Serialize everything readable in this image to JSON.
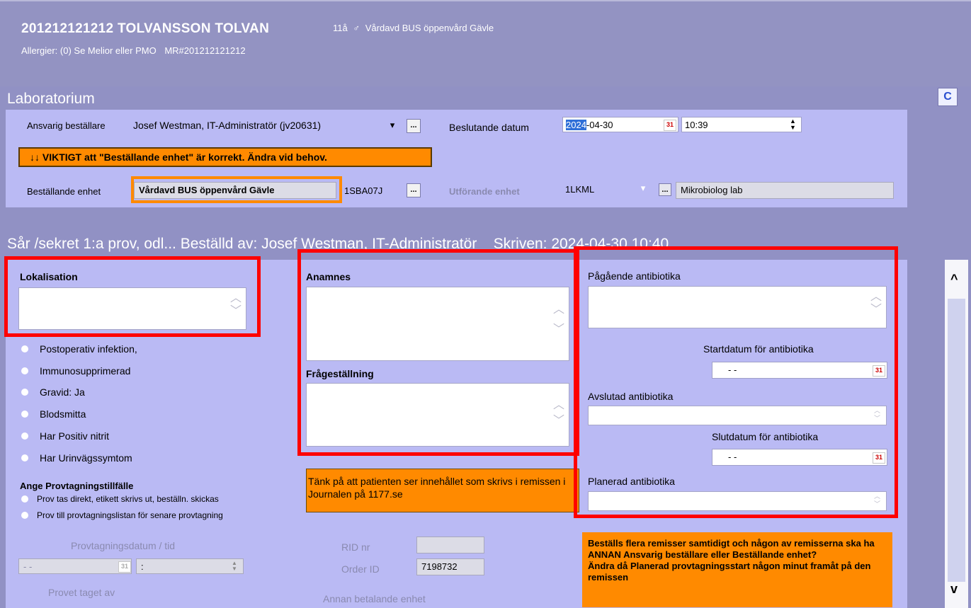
{
  "patient": {
    "name": "201212121212 TOLVANSSON TOLVAN",
    "age": "11å",
    "gender_symbol": "♂",
    "unit": "Vårdavd BUS öppenvård Gävle",
    "allergies": "Allergier: (0) Se Melior eller PMO",
    "mr": "MR#201212121212"
  },
  "lab": {
    "title": "Laboratorium",
    "ansvarig_label": "Ansvarig beställare",
    "ansvarig_value": "Josef Westman, IT-Administratör (jv20631)",
    "beslutande_label": "Beslutande datum",
    "date_year": "2024",
    "date_rest": "-04-30",
    "time_value": "10:39",
    "warning": "↓↓ VIKTIGT att \"Beställande enhet\" är korrekt. Ändra vid behov.",
    "bestallande_label": "Beställande enhet",
    "bestallande_value": "Vårdavd BUS öppenvård Gävle",
    "bestallande_code": "1SBA07J",
    "utforande_label": "Utförande enhet",
    "utforande_code": "1LKML",
    "utforande_name": "Mikrobiolog lab",
    "dots": "..."
  },
  "order": {
    "title": "Sår /sekret 1:a prov, odl... Beställd av: Josef Westman, IT-Administratör    Skriven: 2024-04-30 10:40",
    "lokalisation": "Lokalisation",
    "anamnes": "Anamnes",
    "fragestallning": "Frågeställning",
    "pagaende": "Pågående antibiotika",
    "startdatum": "Startdatum för antibiotika",
    "avslutad": "Avslutad antibiotika",
    "slutdatum": "Slutdatum för antibiotika",
    "planerad": "Planerad antibiotika",
    "date_placeholder": "- -",
    "checks": [
      "Postoperativ infektion,",
      "Immunosupprimerad",
      "Gravid: Ja",
      "Blodsmitta",
      "Har Positiv nitrit",
      "Har Urinvägssymtom"
    ],
    "provtagning_title": "Ange Provtagningstillfälle",
    "provtagning_options": [
      "Prov tas direkt, etikett skrivs ut, beställn. skickas",
      "Prov till provtagningslistan för senare provtagning"
    ],
    "info_orange": "Tänk på att patienten ser innehållet som skrivs i remissen i Journalen på 1177.se",
    "warning_multi": "Beställs flera remisser samtidigt och någon av remisserna ska ha ANNAN Ansvarig beställare eller Beställande enhet?\nÄndra då Planerad provtagningsstart någon minut framåt på den remissen",
    "provtagningsdatum": "Provtagningsdatum / tid",
    "prov_date": "- -",
    "prov_time": ":",
    "provet_taget": "Provet taget av",
    "rid": "RID nr",
    "order_id_label": "Order ID",
    "order_id": "7198732",
    "annan": "Annan betalande enhet"
  },
  "icons": {
    "refresh": "C",
    "scroll_up": "^",
    "scroll_down": "v",
    "calendar": "31"
  }
}
